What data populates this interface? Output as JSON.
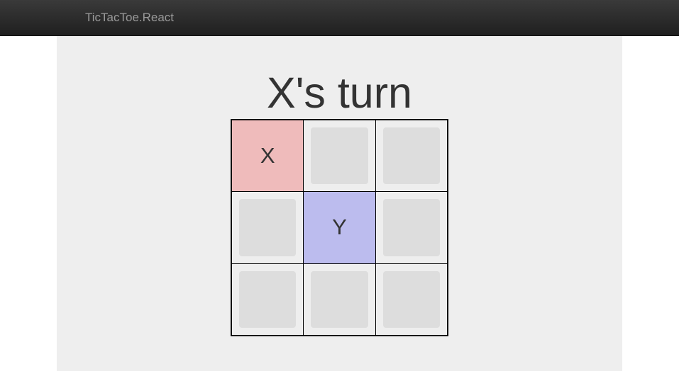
{
  "navbar": {
    "brand": "TicTacToe.React"
  },
  "game": {
    "status": "X's turn",
    "colors": {
      "x_cell": "#efbbbb",
      "y_cell": "#bcbcee",
      "empty_slot": "#dddddd"
    },
    "board": [
      [
        "X",
        "",
        ""
      ],
      [
        "",
        "Y",
        ""
      ],
      [
        "",
        "",
        ""
      ]
    ]
  }
}
